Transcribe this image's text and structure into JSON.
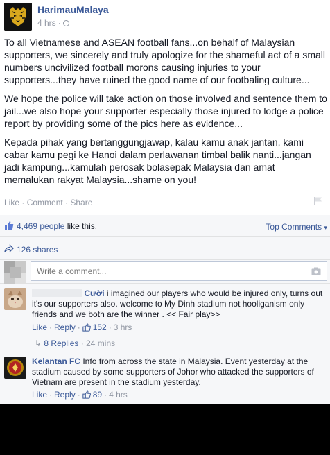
{
  "post": {
    "author": "HarimauMalaya",
    "time": "4 hrs",
    "separator": "·",
    "paragraphs": [
      "To all Vietnamese and ASEAN football fans...on behalf of Malaysian supporters, we sincerely and truly apologize for the shameful act of a small numbers uncivilized football morons causing injuries to your supporters...they have ruined the good name of our footbaling culture...",
      "We hope the police will take action on those involved and sentence them to jail...we also hope your supporter especially those injured to lodge a police report by providing some of the pics here as evidence...",
      "Kepada pihak yang bertanggungjawap, kalau kamu anak jantan, kami cabar kamu pegi ke Hanoi dalam perlawanan timbal balik nanti...jangan jadi kampung...kamulah perosak bolasepak Malaysia dan amat memalukan rakyat Malaysia...shame on you!"
    ],
    "actions": {
      "like": "Like",
      "comment": "Comment",
      "share": "Share",
      "dot": " · "
    }
  },
  "feedback": {
    "likes_count": "4,469 people",
    "likes_suffix": " like this.",
    "top_comments": "Top Comments",
    "shares": "126 shares",
    "write_placeholder": "Write a comment..."
  },
  "comments": [
    {
      "name": "Cười",
      "text": " i imagined our players who would be injured only, turns out it's our supporters also. welcome to My Dinh stadium not hooliganism only friends and we both are the winner . << Fair play>>",
      "like": "Like",
      "reply": "Reply",
      "likes": "152",
      "time": "3 hrs",
      "replies": "8 Replies",
      "replies_time": "24 mins"
    },
    {
      "name": "Kelantan FC",
      "text": " Info from across the state in Malaysia. Event yesterday at the stadium caused by some supporters of Johor who attacked the supporters of Vietnam are present in the stadium yesterday.",
      "like": "Like",
      "reply": "Reply",
      "likes": "89",
      "time": "4 hrs"
    }
  ],
  "colors": {
    "link": "#3b5998",
    "meta": "#9197a3",
    "feedback_bg": "#f6f7f9"
  },
  "icons": [
    "tiger-logo-icon",
    "globe-icon",
    "flag-icon",
    "thumbs-up-icon",
    "share-arrow-icon",
    "camera-icon",
    "dropdown-caret-icon"
  ]
}
